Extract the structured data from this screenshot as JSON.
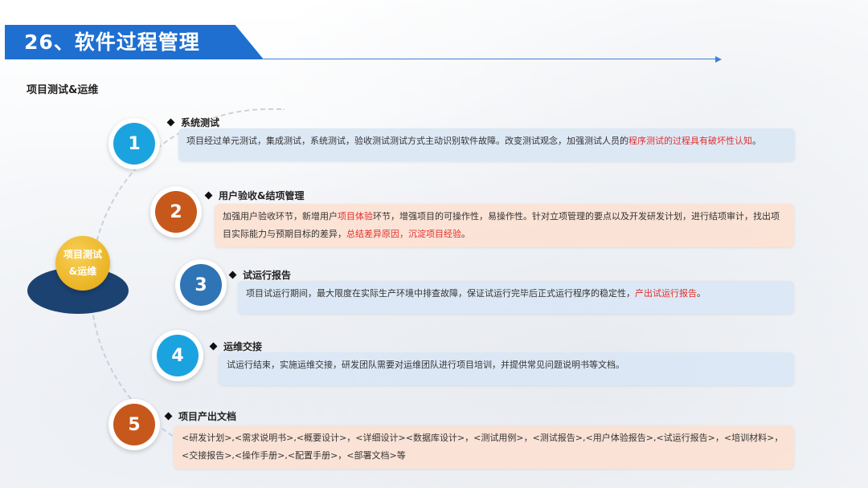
{
  "slide": {
    "title": "26、软件过程管理",
    "section_label": "项目测试&运维",
    "center_label": "项目测试\n&运维"
  },
  "colors": {
    "title_bar": "#1f6fd1",
    "blue_circle": "#1ba3e0",
    "orange_circle": "#c7581b",
    "mid_blue_circle": "#2f74b5",
    "center_gold": "#eab423",
    "center_base": "#1c4271",
    "highlight_red": "#e0302e"
  },
  "items": [
    {
      "number": "1",
      "heading": "系统测试",
      "text_a": "项目经过单元测试，集成测试，系统测试，验收测试测试方式主动识别软件故障。改变测试观念，加强测试人员的",
      "highlight_a": "程序测试的过程具有破坏性认知",
      "text_b": "。"
    },
    {
      "number": "2",
      "heading": "用户验收&结项管理",
      "text_a": "加强用户验收环节，新增用户",
      "highlight_a": "项目体验",
      "text_b": "环节，增强项目的可操作性，易操作性。针对立项管理的要点以及开发研发计划，进行结项审计，找出项目实际能力与预期目标的差异，",
      "highlight_b": "总结差异原因，沉淀项目经验",
      "text_c": "。"
    },
    {
      "number": "3",
      "heading": "试运行报告",
      "text_a": "项目试运行期间，最大限度在实际生产环境中排查故障，保证试运行完毕后正式运行程序的稳定性，",
      "highlight_a": "产出试运行报告",
      "text_b": "。"
    },
    {
      "number": "4",
      "heading": "运维交接",
      "text_a": "试运行结束，实施运维交接，研发团队需要对运维团队进行项目培训，并提供常见问题说明书等文档。"
    },
    {
      "number": "5",
      "heading": "项目产出文档",
      "text_a": "<研发计划>,<需求说明书>,<概要设计>，<详细设计><数据库设计>，<测试用例>，<测试报告>,<用户体验报告>,<试运行报告>，<培训材料>，<交接报告>,<操作手册>,<配置手册>，<部署文档>等"
    }
  ]
}
